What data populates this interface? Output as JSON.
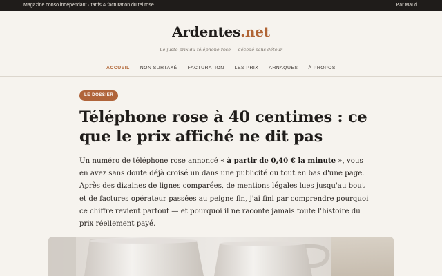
{
  "topbar": {
    "tagline": "Magazine conso indépendant · tarifs & facturation du tel rose",
    "author": "Par Maud"
  },
  "brand": {
    "name": "Ardentes",
    "tld": ".net",
    "tagline": "Le juste prix du téléphone rose — décodé sans détour"
  },
  "nav": {
    "items": [
      {
        "label": "ACCUEIL",
        "active": true
      },
      {
        "label": "NON SURTAXÉ",
        "active": false
      },
      {
        "label": "FACTURATION",
        "active": false
      },
      {
        "label": "LES PRIX",
        "active": false
      },
      {
        "label": "ARNAQUES",
        "active": false
      },
      {
        "label": "À PROPOS",
        "active": false
      }
    ]
  },
  "article": {
    "kicker": "LE DOSSIER",
    "title": "Téléphone rose à 40 centimes : ce que le prix affiché ne dit pas",
    "lead_before": "Un numéro de téléphone rose annoncé « ",
    "lead_bold": "à partir de 0,40 € la minute",
    "lead_after": " », vous en avez sans doute déjà croisé un dans une publicité ou tout en bas d'une page. Après des dizaines de lignes comparées, de mentions légales lues jusqu'au bout et de factures opérateur passées au peigne fin, j'ai fini par comprendre pourquoi ce chiffre revient partout — et pourquoi il ne raconte jamais toute l'histoire du prix réellement payé."
  },
  "colors": {
    "accent": "#b06434",
    "topbar_bg": "#1f1c1a",
    "page_bg": "#f6f3ee"
  }
}
